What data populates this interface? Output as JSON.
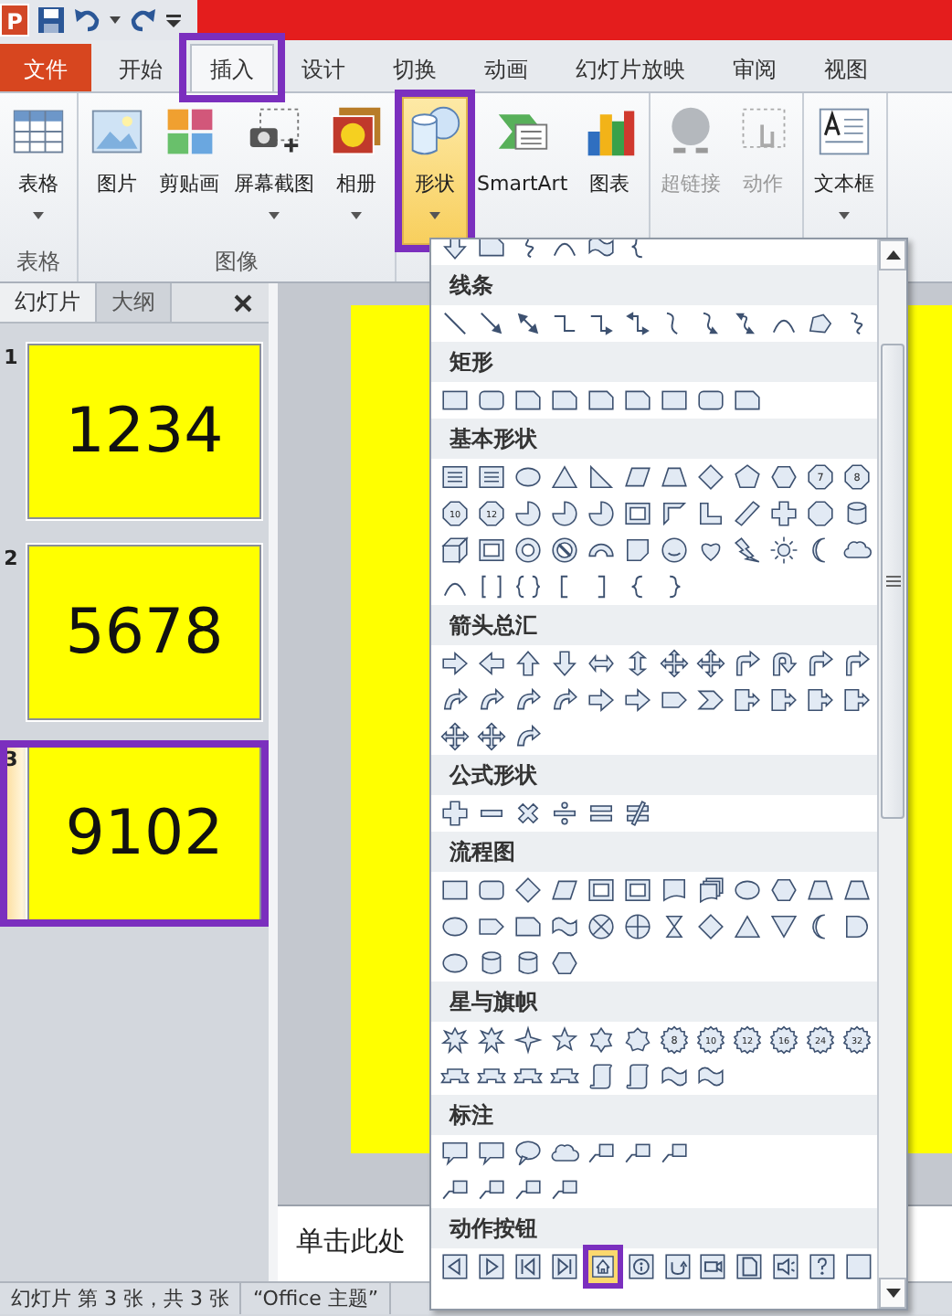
{
  "quick_access": {
    "logo": "P"
  },
  "tabs": [
    {
      "label": "文件",
      "kind": "file",
      "selected": false
    },
    {
      "label": "开始",
      "kind": "plain",
      "selected": false
    },
    {
      "label": "插入",
      "kind": "plain",
      "selected": true
    },
    {
      "label": "设计",
      "kind": "plain",
      "selected": false
    },
    {
      "label": "切换",
      "kind": "plain",
      "selected": false
    },
    {
      "label": "动画",
      "kind": "plain",
      "selected": false
    },
    {
      "label": "幻灯片放映",
      "kind": "plain",
      "selected": false
    },
    {
      "label": "审阅",
      "kind": "plain",
      "selected": false
    },
    {
      "label": "视图",
      "kind": "plain",
      "selected": false
    }
  ],
  "ribbon": {
    "groups": [
      {
        "label": "表格",
        "buttons": [
          {
            "label": "表格",
            "kind": "table",
            "dropdown": true,
            "selected": false,
            "disabled": false
          }
        ]
      },
      {
        "label": "图像",
        "buttons": [
          {
            "label": "图片",
            "kind": "picture",
            "dropdown": false,
            "selected": false,
            "disabled": false
          },
          {
            "label": "剪贴画",
            "kind": "clipart",
            "dropdown": false,
            "selected": false,
            "disabled": false
          },
          {
            "label": "屏幕截图",
            "kind": "screenshot",
            "dropdown": true,
            "selected": false,
            "disabled": false
          },
          {
            "label": "相册",
            "kind": "album",
            "dropdown": true,
            "selected": false,
            "disabled": false
          }
        ]
      },
      {
        "buttons": [
          {
            "label": "形状",
            "kind": "shapes",
            "dropdown": true,
            "selected": true,
            "disabled": false
          },
          {
            "label": "SmartArt",
            "kind": "smartart",
            "dropdown": false,
            "selected": false,
            "disabled": false
          },
          {
            "label": "图表",
            "kind": "chart",
            "dropdown": false,
            "selected": false,
            "disabled": false
          }
        ]
      },
      {
        "buttons": [
          {
            "label": "超链接",
            "kind": "globe",
            "dropdown": false,
            "selected": false,
            "disabled": true
          },
          {
            "label": "动作",
            "kind": "action",
            "dropdown": false,
            "selected": false,
            "disabled": true
          }
        ]
      },
      {
        "buttons": [
          {
            "label": "文本框",
            "kind": "textbox",
            "dropdown": true,
            "selected": false,
            "disabled": false
          }
        ]
      }
    ]
  },
  "slide_pane": {
    "tabs": [
      {
        "label": "幻灯片",
        "selected": true
      },
      {
        "label": "大纲",
        "selected": false
      }
    ],
    "slides": [
      {
        "number": "1",
        "text": "1234",
        "selected": false
      },
      {
        "number": "2",
        "text": "5678",
        "selected": false
      },
      {
        "number": "3",
        "text": "9102",
        "selected": true
      }
    ]
  },
  "notes": {
    "text": "单击此处"
  },
  "status_bar": {
    "slide_info": "幻灯片 第 3 张，共 3 张",
    "theme": "“Office 主题”"
  },
  "shape_gallery": {
    "recent": [
      {
        "kind": "arrowdown",
        "selected": false
      },
      {
        "kind": "snip",
        "selected": false
      },
      {
        "kind": "scribble",
        "selected": false
      },
      {
        "kind": "arcline",
        "selected": false
      },
      {
        "kind": "wave",
        "selected": false
      },
      {
        "kind": "lbrace",
        "selected": false
      }
    ],
    "sections": [
      {
        "title": "线条",
        "rows": [
          [
            {
              "kind": "line",
              "selected": false
            },
            {
              "kind": "arrowline",
              "selected": false
            },
            {
              "kind": "dblline",
              "selected": false
            },
            {
              "kind": "elbow",
              "selected": false
            },
            {
              "kind": "elbowarrow",
              "selected": false
            },
            {
              "kind": "elbowdbl",
              "selected": false
            },
            {
              "kind": "curve",
              "selected": false
            },
            {
              "kind": "curvearrow",
              "selected": false
            },
            {
              "kind": "curvedbl",
              "selected": false
            },
            {
              "kind": "arcline",
              "selected": false
            },
            {
              "kind": "freeform",
              "selected": false
            },
            {
              "kind": "scribble",
              "selected": false
            }
          ]
        ]
      },
      {
        "title": "矩形",
        "rows": [
          [
            {
              "kind": "rect",
              "selected": false
            },
            {
              "kind": "roundrect",
              "selected": false
            },
            {
              "kind": "snip",
              "selected": false
            },
            {
              "kind": "snip",
              "selected": false
            },
            {
              "kind": "snip",
              "selected": false
            },
            {
              "kind": "snip",
              "selected": false
            },
            {
              "kind": "rect",
              "selected": false
            },
            {
              "kind": "roundrect",
              "selected": false
            },
            {
              "kind": "snip",
              "selected": false
            }
          ]
        ]
      },
      {
        "title": "基本形状",
        "rows": [
          [
            {
              "kind": "textbox",
              "selected": false
            },
            {
              "kind": "textbox",
              "selected": false
            },
            {
              "kind": "ellipse",
              "selected": false
            },
            {
              "kind": "triangle",
              "selected": false
            },
            {
              "kind": "rtriangle",
              "selected": false
            },
            {
              "kind": "parallelogram",
              "selected": false
            },
            {
              "kind": "trapezoid",
              "selected": false
            },
            {
              "kind": "diamond",
              "selected": false
            },
            {
              "kind": "pentagon",
              "selected": false
            },
            {
              "kind": "hexagon",
              "selected": false
            },
            {
              "kind": "numbered",
              "label": "7",
              "selected": false
            },
            {
              "kind": "numbered",
              "label": "8",
              "selected": false
            }
          ],
          [
            {
              "kind": "numbered",
              "label": "10",
              "selected": false
            },
            {
              "kind": "numbered",
              "label": "12",
              "selected": false
            },
            {
              "kind": "pie",
              "selected": false
            },
            {
              "kind": "pie",
              "selected": false
            },
            {
              "kind": "pie",
              "selected": false
            },
            {
              "kind": "frame",
              "selected": false
            },
            {
              "kind": "halfframe",
              "selected": false
            },
            {
              "kind": "lshape",
              "selected": false
            },
            {
              "kind": "slash",
              "selected": false
            },
            {
              "kind": "plus",
              "selected": false
            },
            {
              "kind": "octagon",
              "selected": false
            },
            {
              "kind": "cylinder",
              "selected": false
            }
          ],
          [
            {
              "kind": "cube",
              "selected": false
            },
            {
              "kind": "frame",
              "selected": false
            },
            {
              "kind": "donut",
              "selected": false
            },
            {
              "kind": "noentry",
              "selected": false
            },
            {
              "kind": "blockarc",
              "selected": false
            },
            {
              "kind": "fold",
              "selected": false
            },
            {
              "kind": "smiley",
              "selected": false
            },
            {
              "kind": "heart",
              "selected": false
            },
            {
              "kind": "lightning",
              "selected": false
            },
            {
              "kind": "sun",
              "selected": false
            },
            {
              "kind": "moon",
              "selected": false
            },
            {
              "kind": "cloud",
              "selected": false
            }
          ],
          [
            {
              "kind": "arcline",
              "selected": false
            },
            {
              "kind": "dblbracket",
              "selected": false
            },
            {
              "kind": "dblbrace",
              "selected": false
            },
            {
              "kind": "lbracket",
              "selected": false
            },
            {
              "kind": "rbracket",
              "selected": false
            },
            {
              "kind": "lbrace",
              "selected": false
            },
            {
              "kind": "rbrace",
              "selected": false
            }
          ]
        ]
      },
      {
        "title": "箭头总汇",
        "rows": [
          [
            {
              "kind": "arrowright",
              "selected": false
            },
            {
              "kind": "arrowleft",
              "selected": false
            },
            {
              "kind": "arrowup",
              "selected": false
            },
            {
              "kind": "arrowdown",
              "selected": false
            },
            {
              "kind": "arrowlr",
              "selected": false
            },
            {
              "kind": "arrowud",
              "selected": false
            },
            {
              "kind": "quadarrow",
              "selected": false
            },
            {
              "kind": "quadarrow",
              "selected": false
            },
            {
              "kind": "bentarrow",
              "selected": false
            },
            {
              "kind": "uturn",
              "selected": false
            },
            {
              "kind": "bentarrow",
              "selected": false
            },
            {
              "kind": "bentarrow",
              "selected": false
            }
          ],
          [
            {
              "kind": "curvedarrow",
              "selected": false
            },
            {
              "kind": "curvedarrow",
              "selected": false
            },
            {
              "kind": "curvedarrow",
              "selected": false
            },
            {
              "kind": "curvedarrow",
              "selected": false
            },
            {
              "kind": "arrowright",
              "selected": false
            },
            {
              "kind": "arrowright",
              "selected": false
            },
            {
              "kind": "homeplate",
              "selected": false
            },
            {
              "kind": "chevron",
              "selected": false
            },
            {
              "kind": "arrowcallout",
              "selected": false
            },
            {
              "kind": "arrowcallout",
              "selected": false
            },
            {
              "kind": "arrowcallout",
              "selected": false
            },
            {
              "kind": "arrowcallout",
              "selected": false
            }
          ],
          [
            {
              "kind": "quadarrow",
              "selected": false
            },
            {
              "kind": "quadarrow",
              "selected": false
            },
            {
              "kind": "curvedarrow",
              "selected": false
            }
          ]
        ]
      },
      {
        "title": "公式形状",
        "rows": [
          [
            {
              "kind": "plus",
              "selected": false
            },
            {
              "kind": "minus",
              "selected": false
            },
            {
              "kind": "times",
              "selected": false
            },
            {
              "kind": "divide",
              "selected": false
            },
            {
              "kind": "equal",
              "selected": false
            },
            {
              "kind": "notequal",
              "selected": false
            }
          ]
        ]
      },
      {
        "title": "流程图",
        "rows": [
          [
            {
              "kind": "rect",
              "selected": false
            },
            {
              "kind": "roundrect",
              "selected": false
            },
            {
              "kind": "diamond",
              "selected": false
            },
            {
              "kind": "parallelogram",
              "selected": false
            },
            {
              "kind": "frame",
              "selected": false
            },
            {
              "kind": "frame",
              "selected": false
            },
            {
              "kind": "doc",
              "selected": false
            },
            {
              "kind": "multidoc",
              "selected": false
            },
            {
              "kind": "ellipse",
              "selected": false
            },
            {
              "kind": "hexagon",
              "selected": false
            },
            {
              "kind": "trapezoid",
              "selected": false
            },
            {
              "kind": "trapezoid",
              "selected": false
            }
          ],
          [
            {
              "kind": "ellipse",
              "selected": false
            },
            {
              "kind": "homeplate",
              "selected": false
            },
            {
              "kind": "snip",
              "selected": false
            },
            {
              "kind": "wave",
              "selected": false
            },
            {
              "kind": "circlex",
              "selected": false
            },
            {
              "kind": "circleplus",
              "selected": false
            },
            {
              "kind": "hourglass",
              "selected": false
            },
            {
              "kind": "diamond",
              "selected": false
            },
            {
              "kind": "triangle",
              "selected": false
            },
            {
              "kind": "invtriangle",
              "selected": false
            },
            {
              "kind": "moon",
              "selected": false
            },
            {
              "kind": "delay",
              "selected": false
            }
          ],
          [
            {
              "kind": "ellipse",
              "selected": false
            },
            {
              "kind": "cylinder",
              "selected": false
            },
            {
              "kind": "cylinder",
              "selected": false
            },
            {
              "kind": "hexagon",
              "selected": false
            }
          ]
        ]
      },
      {
        "title": "星与旗帜",
        "rows": [
          [
            {
              "kind": "burst",
              "selected": false
            },
            {
              "kind": "burst",
              "selected": false
            },
            {
              "kind": "star4",
              "selected": false
            },
            {
              "kind": "star5",
              "selected": false
            },
            {
              "kind": "star6",
              "selected": false
            },
            {
              "kind": "star7",
              "selected": false
            },
            {
              "kind": "seal",
              "label": "8",
              "selected": false
            },
            {
              "kind": "seal",
              "label": "10",
              "selected": false
            },
            {
              "kind": "seal",
              "label": "12",
              "selected": false
            },
            {
              "kind": "seal",
              "label": "16",
              "selected": false
            },
            {
              "kind": "seal",
              "label": "24",
              "selected": false
            },
            {
              "kind": "seal",
              "label": "32",
              "selected": false
            }
          ],
          [
            {
              "kind": "ribbon",
              "selected": false
            },
            {
              "kind": "ribbon",
              "selected": false
            },
            {
              "kind": "ribbon",
              "selected": false
            },
            {
              "kind": "ribbon",
              "selected": false
            },
            {
              "kind": "scroll",
              "selected": false
            },
            {
              "kind": "scroll",
              "selected": false
            },
            {
              "kind": "wave",
              "selected": false
            },
            {
              "kind": "wave",
              "selected": false
            }
          ]
        ]
      },
      {
        "title": "标注",
        "rows": [
          [
            {
              "kind": "callout",
              "selected": false
            },
            {
              "kind": "callout",
              "selected": false
            },
            {
              "kind": "ovalcallout",
              "selected": false
            },
            {
              "kind": "cloud",
              "selected": false
            },
            {
              "kind": "linecallout",
              "selected": false
            },
            {
              "kind": "linecallout",
              "selected": false
            },
            {
              "kind": "linecallout",
              "selected": false
            }
          ],
          [
            {
              "kind": "linecallout",
              "selected": false
            },
            {
              "kind": "linecallout",
              "selected": false
            },
            {
              "kind": "linecallout",
              "selected": false
            },
            {
              "kind": "linecallout",
              "selected": false
            }
          ]
        ]
      },
      {
        "title": "动作按钮",
        "rows": [
          [
            {
              "kind": "back",
              "selected": false
            },
            {
              "kind": "forward",
              "selected": false
            },
            {
              "kind": "begin",
              "selected": false
            },
            {
              "kind": "end",
              "selected": false
            },
            {
              "kind": "home",
              "selected": true
            },
            {
              "kind": "info",
              "selected": false
            },
            {
              "kind": "return",
              "selected": false
            },
            {
              "kind": "movie",
              "selected": false
            },
            {
              "kind": "document",
              "selected": false
            },
            {
              "kind": "sound",
              "selected": false
            },
            {
              "kind": "help",
              "selected": false
            },
            {
              "kind": "blank",
              "selected": false
            }
          ]
        ]
      }
    ]
  }
}
